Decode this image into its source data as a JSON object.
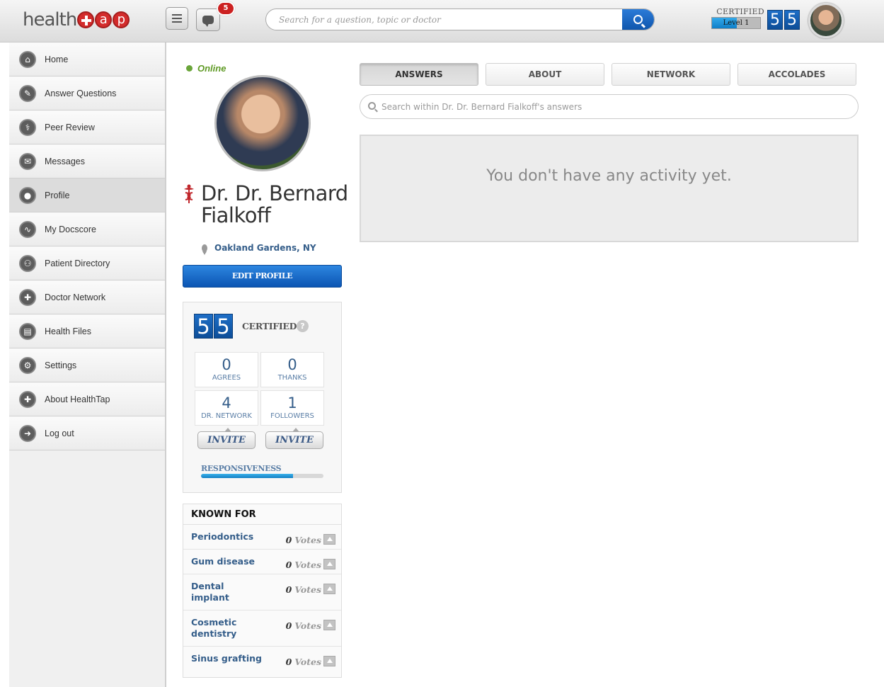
{
  "header": {
    "logo_text": "health",
    "logo_tail": [
      "a",
      "p"
    ],
    "notifications_count": "5",
    "search_placeholder": "Search for a question, topic or doctor",
    "certified_label": "CERTIFIED",
    "level_label": "Level 1",
    "level_fraction": 0.52,
    "score_digits": [
      "5",
      "5"
    ]
  },
  "sidebar": {
    "items": [
      {
        "label": "Home",
        "icon": "home-icon",
        "glyph": "⌂"
      },
      {
        "label": "Answer Questions",
        "icon": "chat-icon",
        "glyph": "✎"
      },
      {
        "label": "Peer Review",
        "icon": "caduceus-icon",
        "glyph": "⚕"
      },
      {
        "label": "Messages",
        "icon": "envelope-icon",
        "glyph": "✉"
      },
      {
        "label": "Profile",
        "icon": "user-icon",
        "glyph": "●",
        "active": true
      },
      {
        "label": "My Docscore",
        "icon": "chart-icon",
        "glyph": "∿"
      },
      {
        "label": "Patient Directory",
        "icon": "people-icon",
        "glyph": "⚇"
      },
      {
        "label": "Doctor Network",
        "icon": "network-icon",
        "glyph": "✚"
      },
      {
        "label": "Health Files",
        "icon": "files-icon",
        "glyph": "▤"
      },
      {
        "label": "Settings",
        "icon": "gear-icon",
        "glyph": "⚙"
      },
      {
        "label": "About HealthTap",
        "icon": "plus-icon",
        "glyph": "✚"
      },
      {
        "label": "Log out",
        "icon": "logout-icon",
        "glyph": "➜"
      }
    ]
  },
  "profile": {
    "status": "Online",
    "name": "Dr. Dr. Bernard Fialkoff",
    "location": "Oakland Gardens, NY",
    "edit_button": "EDIT PROFILE",
    "score_digits": [
      "5",
      "5"
    ],
    "certified_label": "CERTIFIED",
    "help_glyph": "?",
    "stats": [
      {
        "value": "0",
        "label": "AGREES"
      },
      {
        "value": "0",
        "label": "THANKS"
      },
      {
        "value": "4",
        "label": "DR. NETWORK"
      },
      {
        "value": "1",
        "label": "FOLLOWERS"
      }
    ],
    "invite_label": "INVITE",
    "responsiveness_label": "RESPONSIVENESS",
    "responsiveness_fraction": 0.75
  },
  "known_for": {
    "title": "KNOWN FOR",
    "votes_label": "Votes",
    "items": [
      {
        "name": "Periodontics",
        "votes": "0"
      },
      {
        "name": "Gum disease",
        "votes": "0"
      },
      {
        "name": "Dental implant",
        "votes": "0"
      },
      {
        "name": "Cosmetic dentistry",
        "votes": "0"
      },
      {
        "name": "Sinus grafting",
        "votes": "0"
      }
    ]
  },
  "main": {
    "tabs": [
      {
        "label": "ANSWERS",
        "active": true
      },
      {
        "label": "ABOUT"
      },
      {
        "label": "NETWORK"
      },
      {
        "label": "ACCOLADES"
      }
    ],
    "answers_search_placeholder": "Search within Dr. Dr. Bernard Fialkoff's answers",
    "empty_message": "You don't have any activity yet."
  },
  "colors": {
    "brand_red": "#d32b2b",
    "score_blue": "#1d6ec7",
    "link_blue": "#355e8a",
    "online_green": "#5f9a25"
  }
}
